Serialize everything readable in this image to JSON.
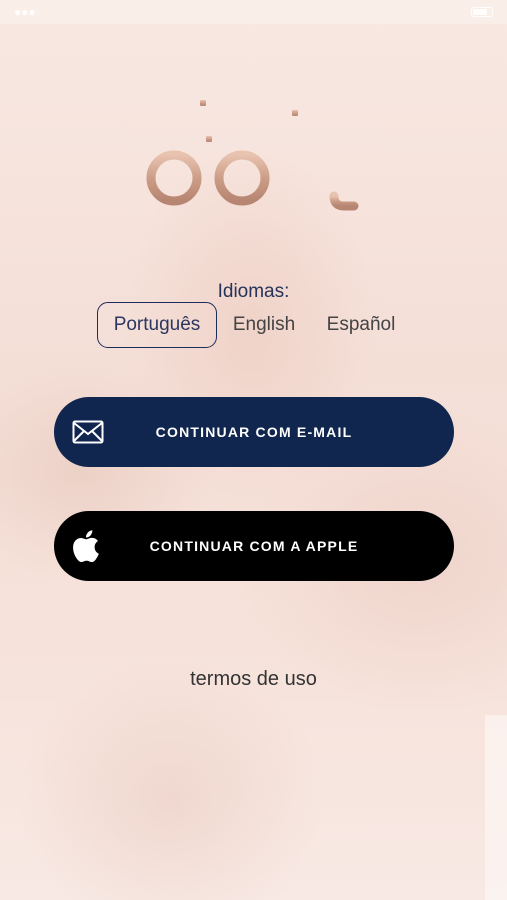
{
  "colors": {
    "accent_navy": "#10264f",
    "apple_black": "#000000",
    "logo_rose_gold": "#c99a84",
    "background": "#f6e3dc"
  },
  "logo": {
    "text": "do it"
  },
  "languages": {
    "label": "Idiomas:",
    "options": [
      "Português",
      "English",
      "Español"
    ],
    "selected": "Português"
  },
  "buttons": {
    "email": {
      "label": "CONTINUAR COM E-MAIL",
      "icon": "envelope-icon"
    },
    "apple": {
      "label": "CONTINUAR COM A APPLE",
      "icon": "apple-icon"
    }
  },
  "footer": {
    "terms_label": "termos de uso"
  }
}
